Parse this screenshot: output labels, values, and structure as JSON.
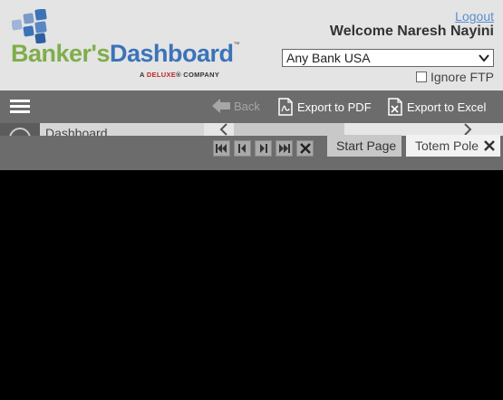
{
  "logo": {
    "part1": "Banker's",
    "part2": "Dashboard",
    "tm": "™",
    "sub_prefix": "A ",
    "sub_brand": "DELUXE",
    "sub_suffix": "® COMPANY",
    "colors": {
      "green": "#7fae4a",
      "blue": "#3b73b9",
      "red": "#c0272d"
    }
  },
  "user": {
    "logout_label": "Logout",
    "welcome": "Welcome  Naresh Nayini"
  },
  "bank_select": {
    "value": "Any Bank USA"
  },
  "ignore_ftp": {
    "label": "Ignore FTP",
    "checked": false
  },
  "toolbar": {
    "back_label": "Back",
    "export_pdf_label": "Export to PDF",
    "export_excel_label": "Export to Excel"
  },
  "sidebar": {
    "item_label": "Dashboard"
  },
  "tabs": {
    "start_label": "Start Page",
    "totem_label": "Totem Pole"
  },
  "icons": [
    "menu-icon",
    "back-arrow-icon",
    "pdf-icon",
    "excel-icon",
    "first-page-icon",
    "prev-page-icon",
    "next-page-icon",
    "last-page-icon",
    "close-icon",
    "chevron-down-icon",
    "chevron-left-icon",
    "chevron-right-icon"
  ]
}
